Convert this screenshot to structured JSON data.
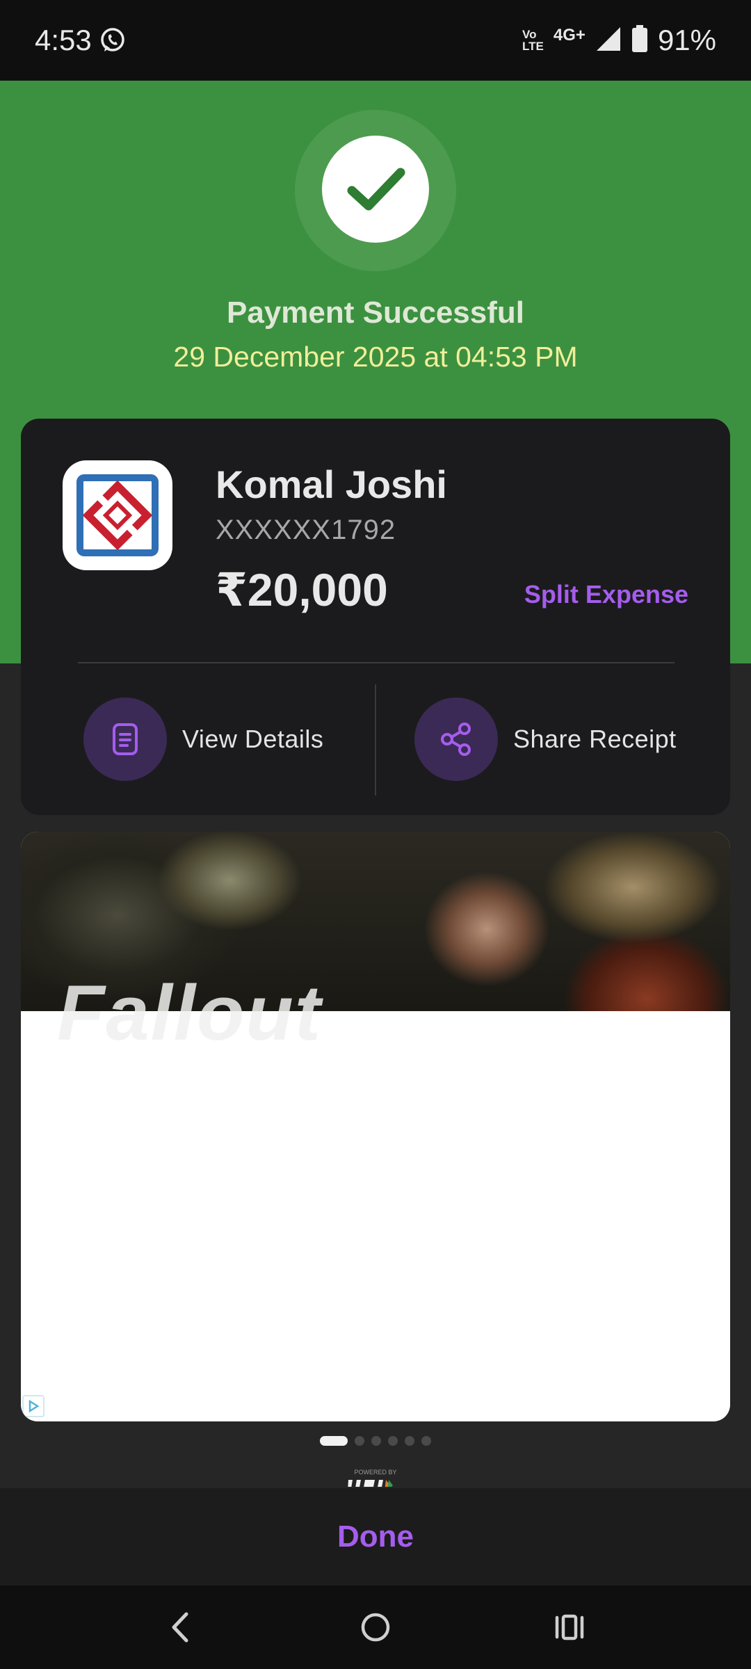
{
  "status_bar": {
    "time": "4:53",
    "network_volte_top": "Vo",
    "network_volte_bottom": "LTE",
    "network_type": "4G+",
    "battery": "91%",
    "icons": [
      "whatsapp-icon",
      "volte-icon",
      "signal-icon",
      "battery-icon"
    ]
  },
  "hero": {
    "status_icon": "check-icon",
    "title": "Payment Successful",
    "datetime": "29 December 2025 at 04:53 PM"
  },
  "payee": {
    "bank_icon": "bank-logo-icon",
    "name": "Komal Joshi",
    "account": "XXXXXX1792",
    "amount": "₹20,000",
    "split_label": "Split Expense"
  },
  "actions": {
    "view_details": "View Details",
    "share_receipt": "Share Receipt"
  },
  "ad": {
    "image_text": "Fallout",
    "pager_count": 6,
    "pager_active": 0
  },
  "footer": {
    "powered_by": "POWERED BY",
    "done_label": "Done"
  },
  "nav": {
    "icons": [
      "back-icon",
      "home-icon",
      "recents-icon"
    ]
  },
  "colors": {
    "success_green": "#3c9140",
    "accent_purple": "#a55ded",
    "card_dark": "#1b1b1d"
  }
}
